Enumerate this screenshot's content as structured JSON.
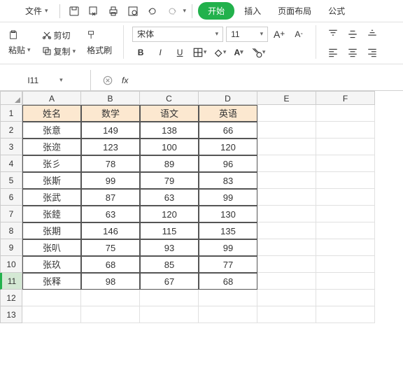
{
  "menu": {
    "file": "文件"
  },
  "tabs": {
    "start": "开始",
    "insert": "插入",
    "layout": "页面布局",
    "formula": "公式"
  },
  "ribbon": {
    "paste": "粘贴",
    "cut": "剪切",
    "copy": "复制",
    "format": "格式刷",
    "font": "宋体",
    "fontsize": "11",
    "bold": "B",
    "italic": "I",
    "underline": "U"
  },
  "namebox": "I11",
  "fx": "fx",
  "cols": [
    "A",
    "B",
    "C",
    "D",
    "E",
    "F"
  ],
  "rows": [
    1,
    2,
    3,
    4,
    5,
    6,
    7,
    8,
    9,
    10,
    11,
    12,
    13
  ],
  "headers": [
    "姓名",
    "数学",
    "语文",
    "英语"
  ],
  "data": [
    [
      "张意",
      "149",
      "138",
      "66"
    ],
    [
      "张迩",
      "123",
      "100",
      "120"
    ],
    [
      "张彡",
      "78",
      "89",
      "96"
    ],
    [
      "张斯",
      "99",
      "79",
      "83"
    ],
    [
      "张武",
      "87",
      "63",
      "99"
    ],
    [
      "张錴",
      "63",
      "120",
      "130"
    ],
    [
      "张期",
      "146",
      "115",
      "135"
    ],
    [
      "张叭",
      "75",
      "93",
      "99"
    ],
    [
      "张玖",
      "68",
      "85",
      "77"
    ],
    [
      "张释",
      "98",
      "67",
      "68"
    ]
  ],
  "chart_data": {
    "type": "table",
    "title": "",
    "columns": [
      "姓名",
      "数学",
      "语文",
      "英语"
    ],
    "rows": [
      {
        "姓名": "张意",
        "数学": 149,
        "语文": 138,
        "英语": 66
      },
      {
        "姓名": "张迩",
        "数学": 123,
        "语文": 100,
        "英语": 120
      },
      {
        "姓名": "张彡",
        "数学": 78,
        "语文": 89,
        "英语": 96
      },
      {
        "姓名": "张斯",
        "数学": 99,
        "语文": 79,
        "英语": 83
      },
      {
        "姓名": "张武",
        "数学": 87,
        "语文": 63,
        "英语": 99
      },
      {
        "姓名": "张錴",
        "数学": 63,
        "语文": 120,
        "英语": 130
      },
      {
        "姓名": "张期",
        "数学": 146,
        "语文": 115,
        "英语": 135
      },
      {
        "姓名": "张叭",
        "数学": 75,
        "语文": 93,
        "英语": 99
      },
      {
        "姓名": "张玖",
        "数学": 68,
        "语文": 85,
        "英语": 77
      },
      {
        "姓名": "张释",
        "数学": 98,
        "语文": 67,
        "英语": 68
      }
    ]
  }
}
